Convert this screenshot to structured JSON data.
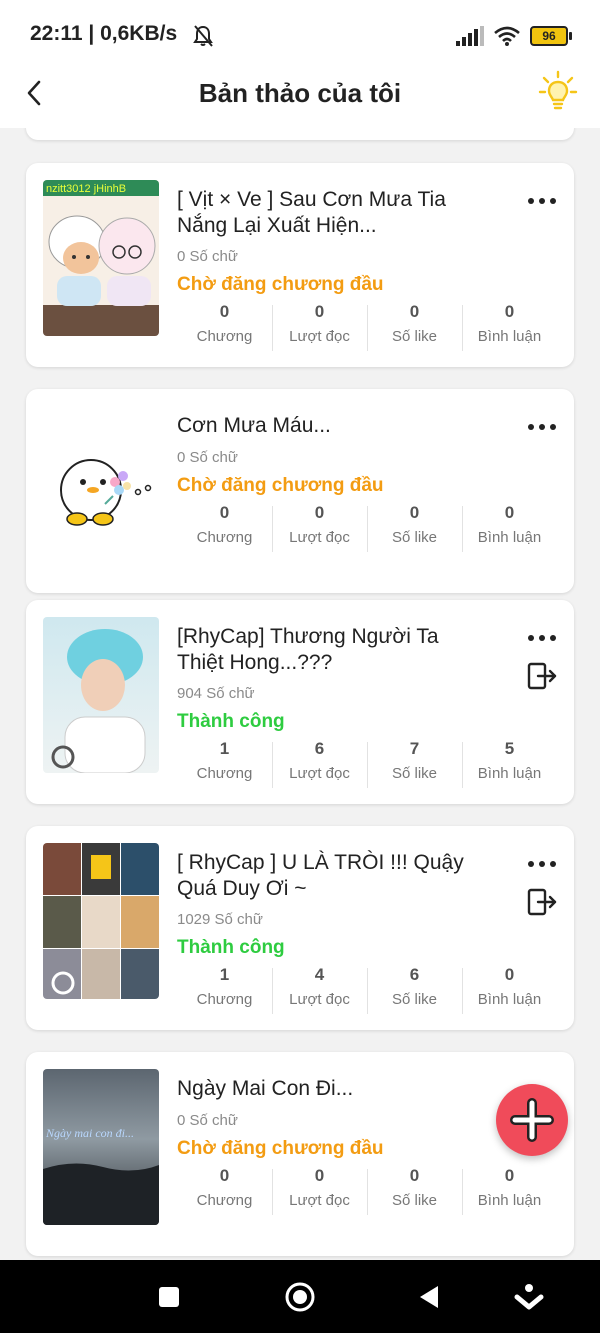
{
  "status_bar": {
    "time": "22:11 | 0,6KB/s",
    "battery": "96"
  },
  "header": {
    "title": "Bản thảo của tôi",
    "back_icon": "chevron-left-icon",
    "tip_icon": "lightbulb-icon"
  },
  "colors": {
    "pending": "#f39c12",
    "success": "#2ecc40",
    "fab": "#f04b5a"
  },
  "stat_labels": {
    "chapters": "Chương",
    "reads": "Lượt đọc",
    "likes": "Số like",
    "comments": "Bình luận"
  },
  "stories": [
    {
      "title": "[ Vịt × Ve ] Sau Cơn Mưa Tia Nắng Lại Xuất Hiện...",
      "words": "0 Số chữ",
      "status": "Chờ đăng chương đầu",
      "cover_caption": "nzitt3012 jHinhB",
      "stats": {
        "chapters": "0",
        "reads": "0",
        "likes": "0",
        "comments": "0"
      }
    },
    {
      "title": "Cơn Mưa Máu...",
      "words": "0 Số chữ",
      "status": "Chờ đăng chương đầu",
      "stats": {
        "chapters": "0",
        "reads": "0",
        "likes": "0",
        "comments": "0"
      }
    },
    {
      "title": "[RhyCap] Thương Người Ta Thiệt Hong...???",
      "words": "904 Số chữ",
      "status": "Thành công",
      "stats": {
        "chapters": "1",
        "reads": "6",
        "likes": "7",
        "comments": "5"
      }
    },
    {
      "title": "[ RhyCap ] U LÀ TRÒI !!! Quậy Quá Duy Ơi ~",
      "words": "1029 Số chữ",
      "status": "Thành công",
      "stats": {
        "chapters": "1",
        "reads": "4",
        "likes": "6",
        "comments": "0"
      }
    },
    {
      "title": "Ngày Mai Con Đi...",
      "words": "0 Số chữ",
      "status": "Chờ đăng chương đầu",
      "cover_caption": "Ngày mai con đi...",
      "stats": {
        "chapters": "0",
        "reads": "0",
        "likes": "0",
        "comments": "0"
      }
    }
  ],
  "nav": {
    "recents_icon": "square-icon",
    "home_icon": "circle-icon",
    "back_icon": "triangle-back-icon",
    "assistant_icon": "chevron-down-icon"
  }
}
